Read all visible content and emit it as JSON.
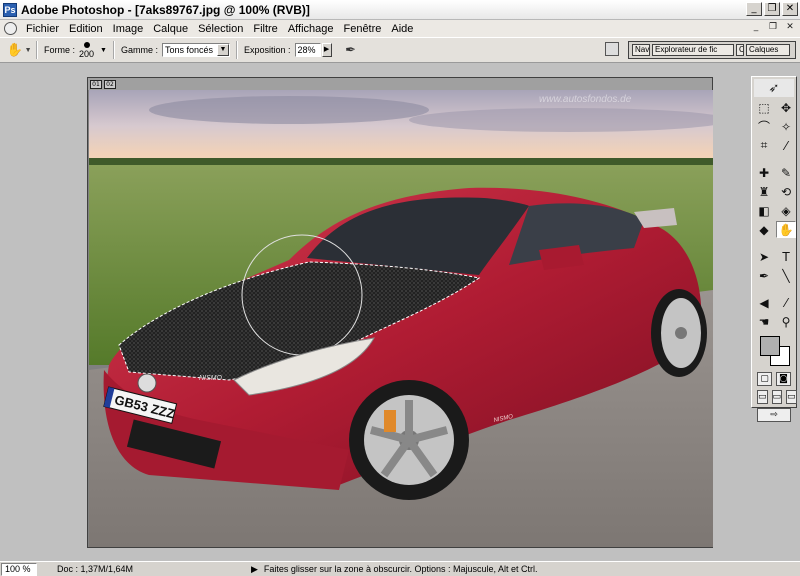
{
  "window": {
    "title": "Adobe Photoshop - [7aks89767.jpg @ 100% (RVB)]",
    "app_icon": "photoshop-icon",
    "controls": [
      "_",
      "❐",
      "✕"
    ]
  },
  "menubar": {
    "items": [
      "Fichier",
      "Edition",
      "Image",
      "Calque",
      "Sélection",
      "Filtre",
      "Affichage",
      "Fenêtre",
      "Aide"
    ],
    "doc_controls": [
      "_",
      "❐",
      "✕"
    ]
  },
  "options": {
    "brush_label": "Forme :",
    "brush_size": "200",
    "range_label": "Gamme :",
    "range_value": "Tons foncés",
    "exposure_label": "Exposition :",
    "exposure_value": "28%",
    "palette_tabs": [
      "Nav",
      "Explorateur de fic",
      "C",
      "Calques"
    ]
  },
  "document": {
    "header_boxes": [
      "01",
      "02"
    ],
    "watermark": "www.autosfondos.de"
  },
  "status": {
    "zoom": "100 %",
    "doc_info": "Doc : 1,37M/1,64M",
    "hint": "Faites glisser sur la zone à obscurcir. Options : Majuscule, Alt et Ctrl."
  },
  "photo": {
    "license_plate": "GB53 ZZZ",
    "hood_badge": "NISMO",
    "side_badge": "NISMO"
  },
  "colors": {
    "car_body": "#b01c33",
    "sky": "#c9bdc8",
    "grass": "#6f8f3a",
    "gravel": "#8a8583",
    "carbon_hood": "#1e1e1e"
  }
}
